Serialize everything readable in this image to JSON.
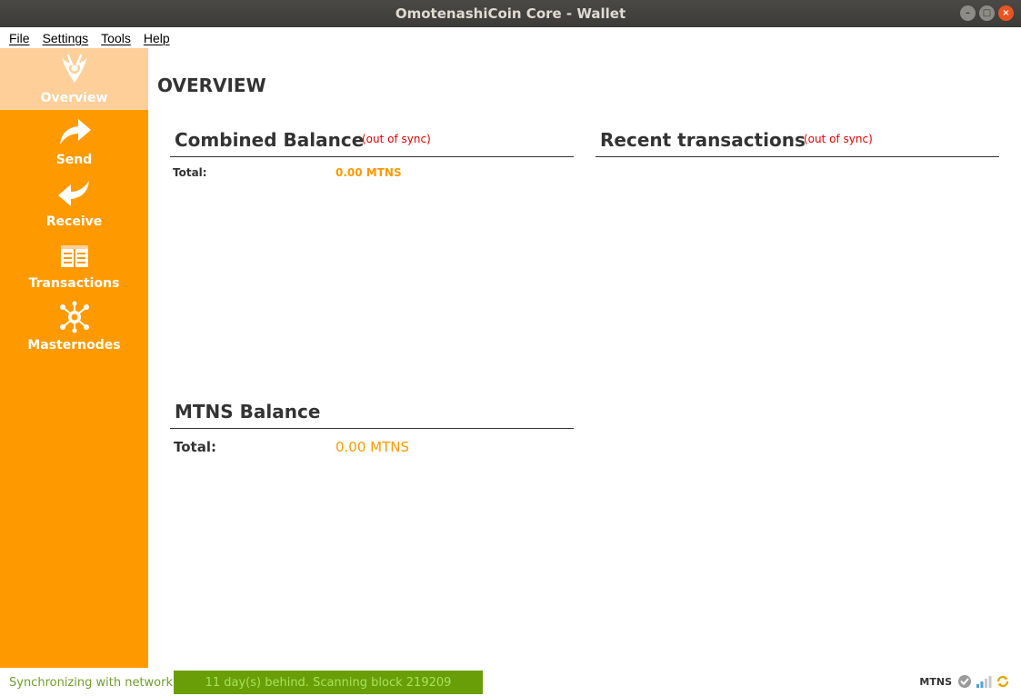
{
  "window": {
    "title": "OmotenashiCoin Core - Wallet"
  },
  "menu": [
    "File",
    "Settings",
    "Tools",
    "Help"
  ],
  "sidebar": {
    "items": [
      {
        "label": "Overview",
        "icon": "logo-icon",
        "active": true
      },
      {
        "label": "Send",
        "icon": "send-arrow-icon",
        "active": false
      },
      {
        "label": "Receive",
        "icon": "receive-arrow-icon",
        "active": false
      },
      {
        "label": "Transactions",
        "icon": "transactions-icon",
        "active": false
      },
      {
        "label": "Masternodes",
        "icon": "masternodes-icon",
        "active": false
      }
    ]
  },
  "overview": {
    "title": "OVERVIEW",
    "combined": {
      "title": "Combined Balance",
      "sync_status": "(out of sync)",
      "total_label": "Total:",
      "total_value": "0.00 MTNS"
    },
    "recent": {
      "title": "Recent transactions",
      "sync_status": "(out of sync)"
    },
    "mtns": {
      "title": "MTNS Balance",
      "total_label": "Total:",
      "total_value": "0.00 MTNS"
    }
  },
  "status": {
    "sync_text": "Synchronizing with network...",
    "progress_text": "11 day(s) behind. Scanning block 219209",
    "unit": "MTNS"
  },
  "colors": {
    "accent": "#fe9a00",
    "active_nav": "#fecf98",
    "out_of_sync": "#ee0000",
    "progress": "#6a9e08"
  }
}
